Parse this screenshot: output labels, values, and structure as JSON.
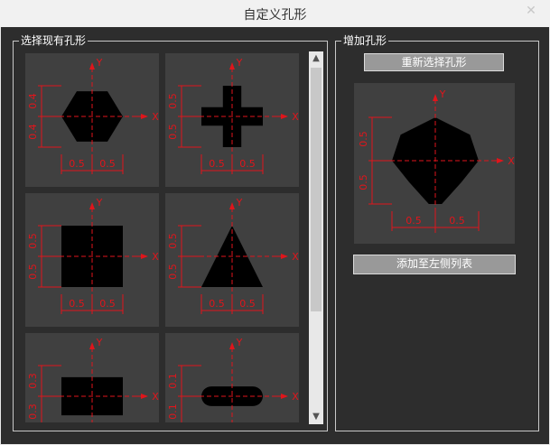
{
  "window": {
    "title": "自定义孔形",
    "close_glyph": "✕"
  },
  "left_group": {
    "label": "选择现有孔形",
    "scroll_up_glyph": "▲",
    "scroll_down_glyph": "▼",
    "thumbs": [
      {
        "shape": "hexagon",
        "dims_left": [
          "0.4",
          "0.4"
        ],
        "dims_bottom": [
          "0.5",
          "0.5"
        ]
      },
      {
        "shape": "cross",
        "dims_left": [
          "0.5",
          "0.5"
        ],
        "dims_bottom": [
          "0.5",
          "0.5"
        ]
      },
      {
        "shape": "rectangle",
        "dims_left": [
          "0.5",
          "0.5"
        ],
        "dims_bottom": [
          "0.5",
          "0.5"
        ]
      },
      {
        "shape": "triangle",
        "dims_left": [
          "0.5",
          "0.5"
        ],
        "dims_bottom": [
          "0.5",
          "0.5"
        ]
      },
      {
        "shape": "square",
        "dims_left": [
          "0.3",
          "0.3"
        ],
        "dims_bottom": []
      },
      {
        "shape": "slot",
        "dims_left": [
          "0.1",
          "0.1"
        ],
        "dims_bottom": []
      }
    ]
  },
  "right_group": {
    "label": "增加孔形",
    "reselect_label": "重新选择孔形",
    "add_label": "添加至左侧列表",
    "preview": {
      "shape": "heptagon",
      "dims_left": [
        "0.5",
        "0.5"
      ],
      "dims_bottom": [
        "0.5",
        "0.5"
      ]
    }
  },
  "axis": {
    "x_label": "X",
    "y_label": "Y"
  },
  "colors": {
    "dim": "#e0151b",
    "shape": "#000000",
    "panel": "#404040",
    "frame": "#2d2d2d"
  }
}
